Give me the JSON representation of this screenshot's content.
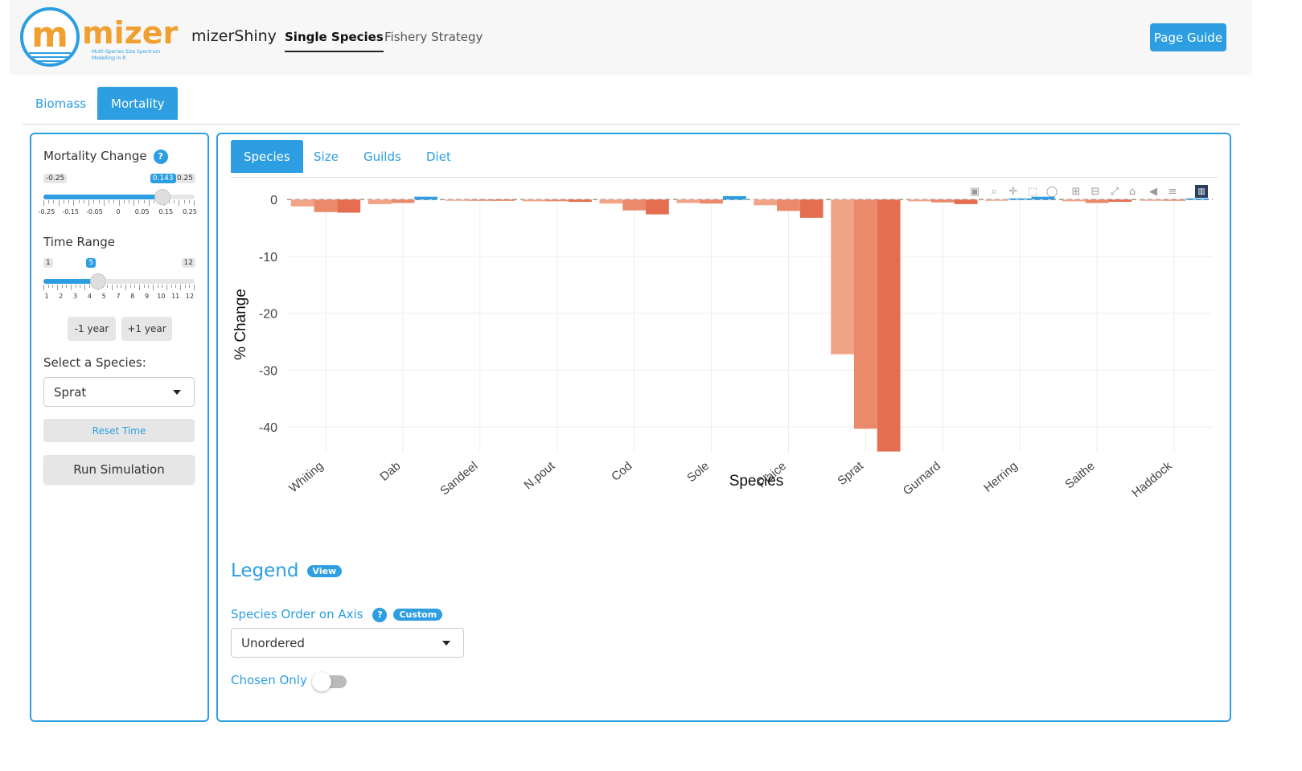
{
  "navbar": {
    "logo_text": "mizer",
    "logo_tagline_1": "Multi-Species Size Spectrum",
    "logo_tagline_2": "Modelling in R",
    "brand": "mizerShiny",
    "links": [
      "Single Species",
      "Fishery Strategy"
    ],
    "active_link": "Single Species",
    "page_guide": "Page Guide"
  },
  "top_tabs": [
    "Biomass",
    "Mortality"
  ],
  "active_top_tab": "Mortality",
  "sidebar": {
    "mortality_label": "Mortality Change",
    "mortality_slider": {
      "min": "-0.25",
      "max": "0.25",
      "value": "0.143",
      "value_fraction": 0.786,
      "tick_labels": [
        "-0.25",
        "-0.15",
        "-0.05",
        "0",
        "0.05",
        "0.15",
        "0.25"
      ]
    },
    "time_label": "Time Range",
    "time_slider": {
      "min": "1",
      "max": "12",
      "value": "5",
      "value_fraction": 0.364,
      "tick_labels": [
        "1",
        "2",
        "3",
        "4",
        "5",
        "7",
        "8",
        "9",
        "10",
        "11",
        "12"
      ]
    },
    "minus_year": "-1 year",
    "plus_year": "+1 year",
    "species_label": "Select a Species:",
    "species_value": "Sprat",
    "reset_time": "Reset Time",
    "run_simulation": "Run Simulation"
  },
  "inner_tabs": [
    "Species",
    "Size",
    "Guilds",
    "Diet"
  ],
  "active_inner_tab": "Species",
  "modebar_icons": [
    "camera-icon",
    "zoom-icon",
    "pan-icon",
    "box-select-icon",
    "lasso-icon",
    "zoom-in-icon",
    "zoom-out-icon",
    "autoscale-icon",
    "home-icon",
    "hover-closest-icon",
    "hover-compare-icon",
    "plotly-logo-icon"
  ],
  "chart_data": {
    "type": "bar",
    "xlabel": "Species",
    "ylabel": "% Change",
    "ylim": [
      -44.5,
      0.6
    ],
    "yticks": [
      0,
      -10,
      -20,
      -30,
      -40
    ],
    "categories": [
      "Whiting",
      "Dab",
      "Sandeel",
      "N.pout",
      "Cod",
      "Sole",
      "Plaice",
      "Sprat",
      "Gurnard",
      "Herring",
      "Saithe",
      "Haddock"
    ],
    "series": [
      {
        "values": [
          -1.2,
          -0.8,
          -0.1,
          -0.3,
          -0.7,
          -0.6,
          -1.0,
          -27.2,
          -0.3,
          -0.2,
          -0.3,
          -0.2
        ]
      },
      {
        "values": [
          -2.2,
          -0.6,
          -0.1,
          -0.3,
          -1.9,
          -0.7,
          -2.0,
          -40.3,
          -0.5,
          0.2,
          -0.6,
          -0.2
        ]
      },
      {
        "values": [
          -2.3,
          0.5,
          -0.1,
          -0.4,
          -2.6,
          0.6,
          -3.2,
          -44.3,
          -0.8,
          0.5,
          -0.4,
          0.2
        ]
      }
    ],
    "colors": {
      "neg": [
        "#f2a487",
        "#eb8a6b",
        "#e66e50"
      ],
      "pos": [
        "#2c9ee1",
        "#2c9ee1",
        "#2c9ee1"
      ]
    },
    "grid": true
  },
  "legend": {
    "title": "Legend",
    "view_badge": "View",
    "order_label": "Species Order on Axis",
    "custom_badge": "Custom",
    "order_value": "Unordered",
    "chosen_only": "Chosen Only"
  },
  "colors": {
    "accent": "#2c9ee1"
  }
}
